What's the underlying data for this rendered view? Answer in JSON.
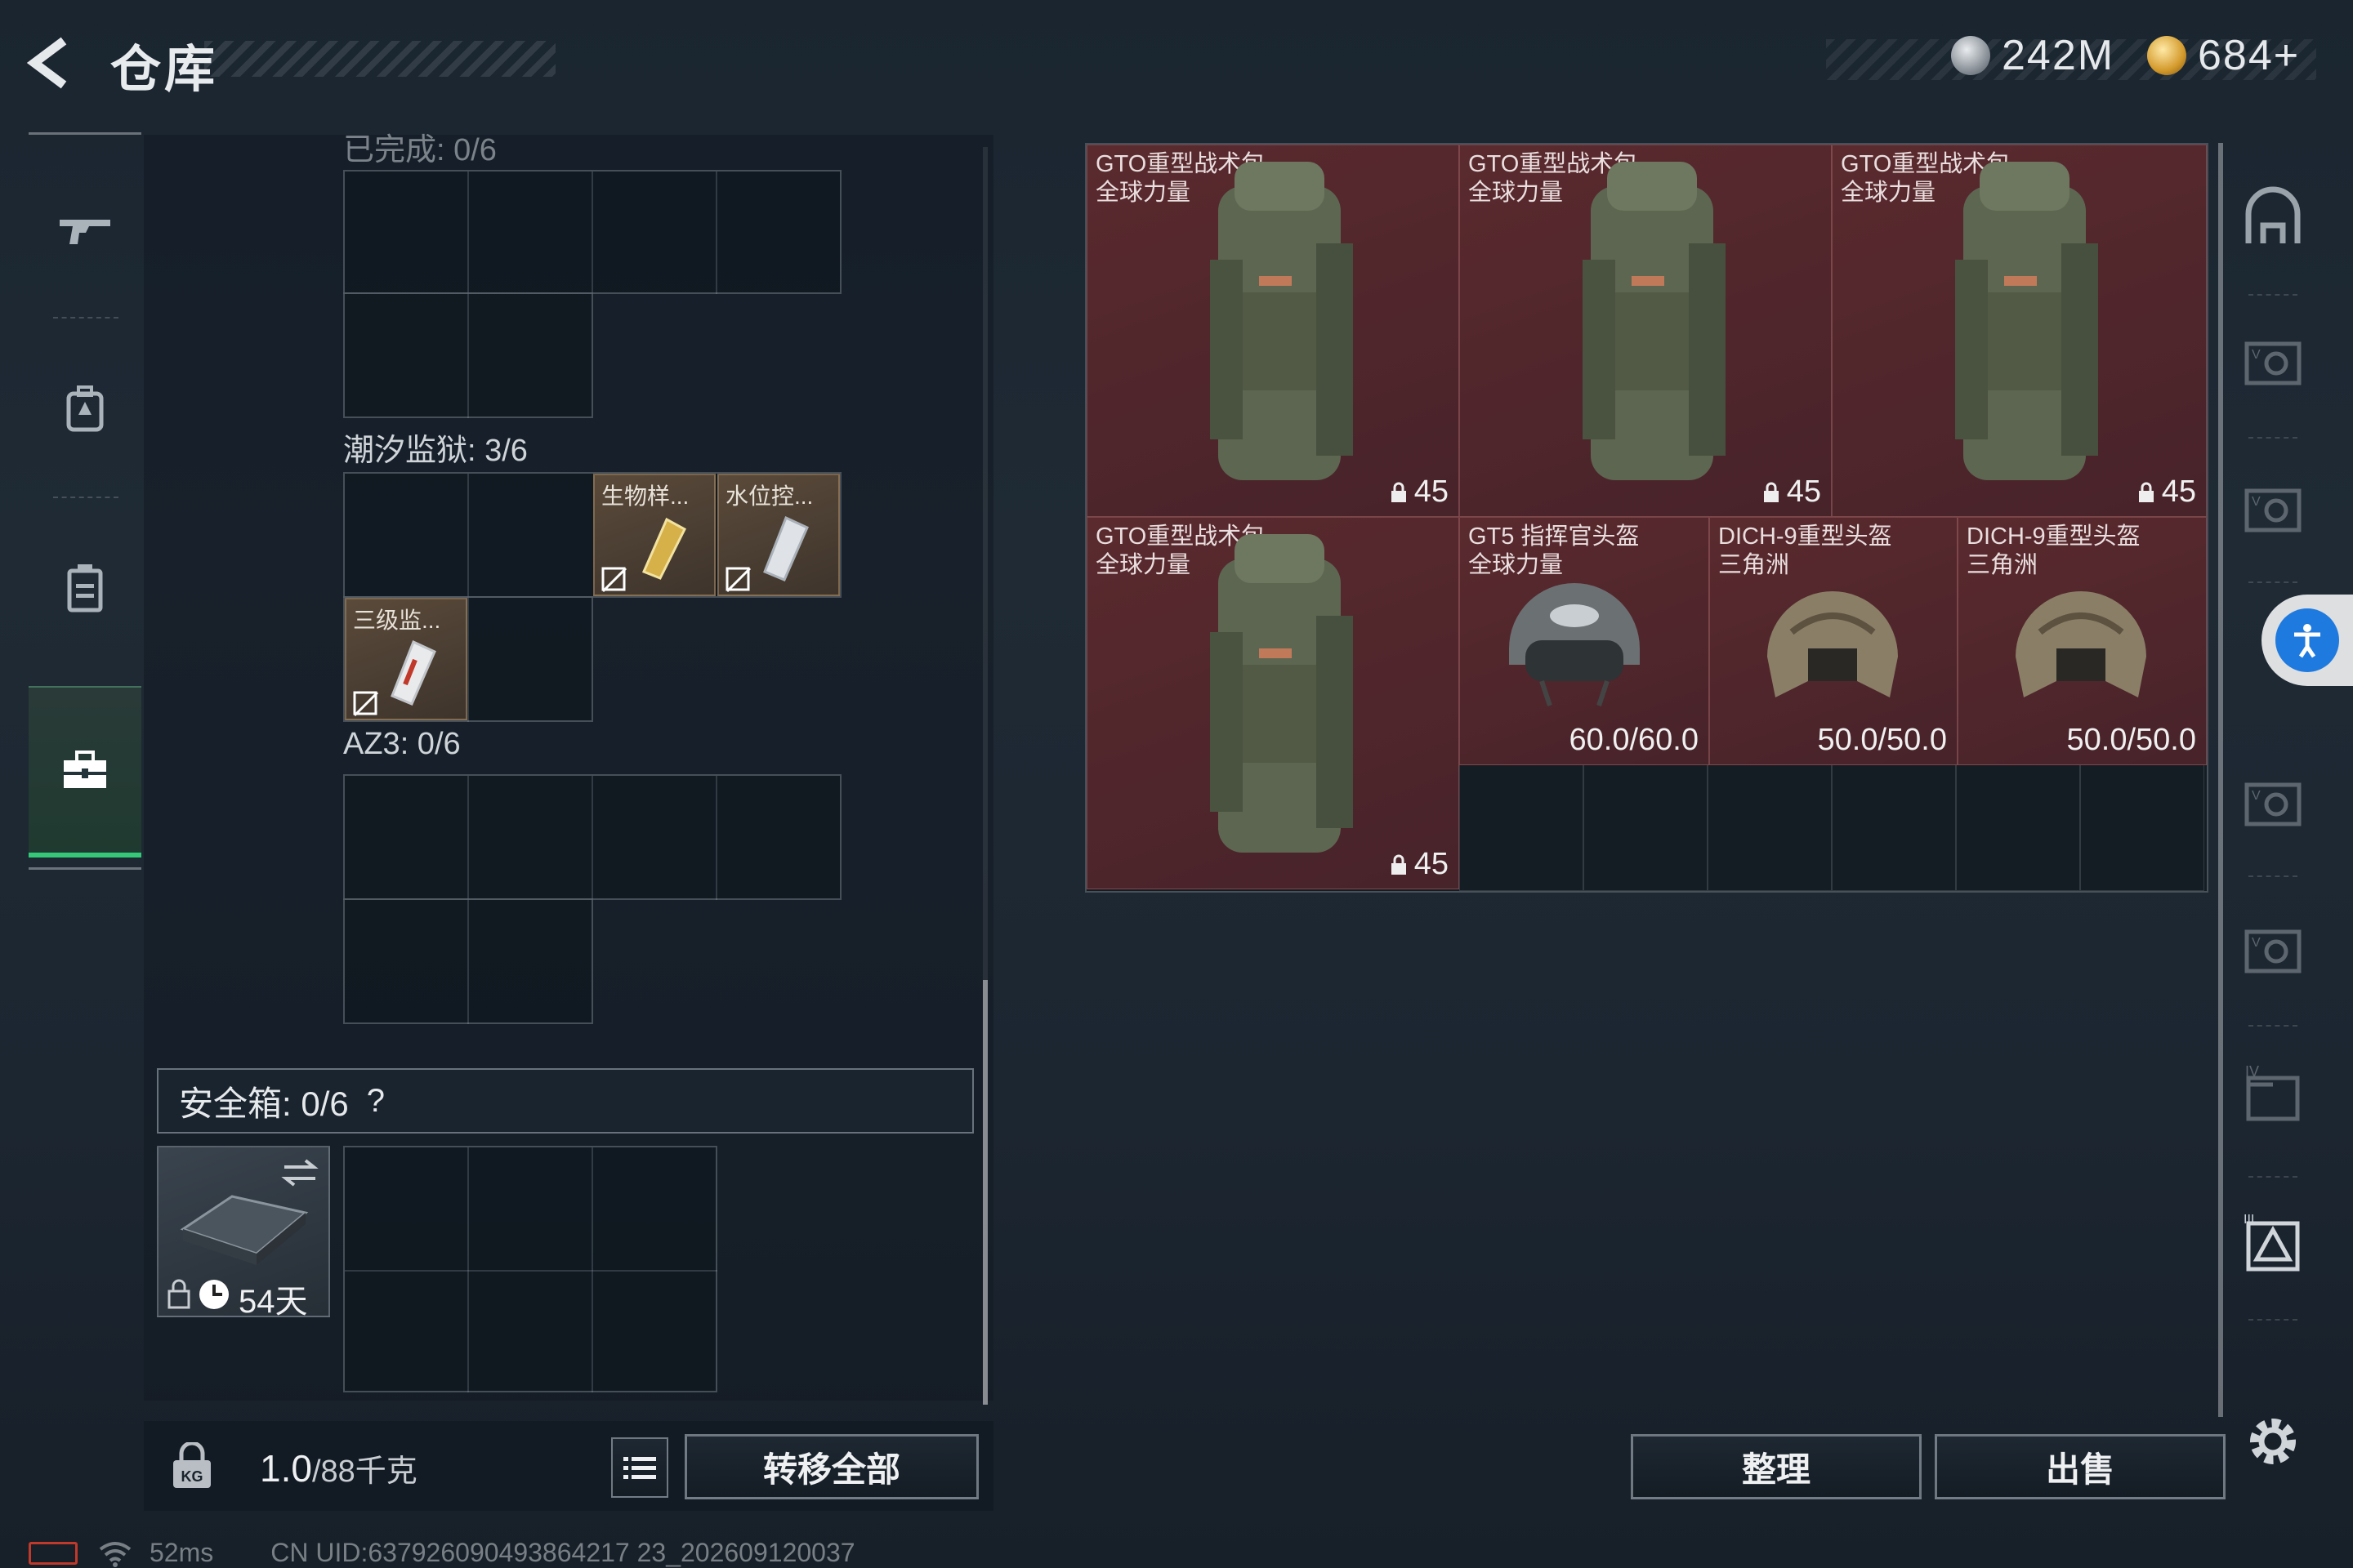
{
  "header": {
    "title": "仓库",
    "currency_silver": "242M",
    "currency_gold": "684+"
  },
  "left_panel": {
    "partial_top_label": "已完成: 0/6",
    "section_tide_prison": "潮汐监狱: 3/6",
    "section_az3": "AZ3: 0/6",
    "items": [
      {
        "name": "生物样..."
      },
      {
        "name": "水位控..."
      },
      {
        "name": "三级监..."
      }
    ],
    "safe_box": {
      "label": "安全箱: 0/6",
      "help": "?",
      "duration": "54天"
    },
    "weight_value": "1.0",
    "weight_unit": "/88千克",
    "transfer_all": "转移全部"
  },
  "stash": {
    "items": [
      {
        "name": "GTO重型战术包\n全球力量",
        "value": "45"
      },
      {
        "name": "GTO重型战术包\n全球力量",
        "value": "45"
      },
      {
        "name": "GTO重型战术包\n全球力量",
        "value": "45"
      },
      {
        "name": "GTO重型战术包\n全球力量",
        "value": "45"
      },
      {
        "name": "GT5 指挥官头盔\n全球力量",
        "value": "60.0/60.0"
      },
      {
        "name": "DICH-9重型头盔\n三角洲",
        "value": "50.0/50.0"
      },
      {
        "name": "DICH-9重型头盔\n三角洲",
        "value": "50.0/50.0"
      }
    ],
    "sort_button": "整理",
    "sell_button": "出售"
  },
  "status_bar": {
    "ping": "52ms",
    "uid": "CN UID:637926090493864217 23_202609120037"
  },
  "colors": {
    "accent_green": "#35c879",
    "item_red": "#5a2a2e",
    "item_brown": "#5a4a3a"
  },
  "icons": [
    "back-icon",
    "rifle-icon",
    "backpack-icon",
    "vest-icon",
    "toolbox-icon",
    "helmet-icon",
    "gear-icon",
    "accessibility-icon",
    "lock-icon",
    "list-icon",
    "swap-icon",
    "clock-icon",
    "wifi-icon",
    "battery-icon"
  ]
}
